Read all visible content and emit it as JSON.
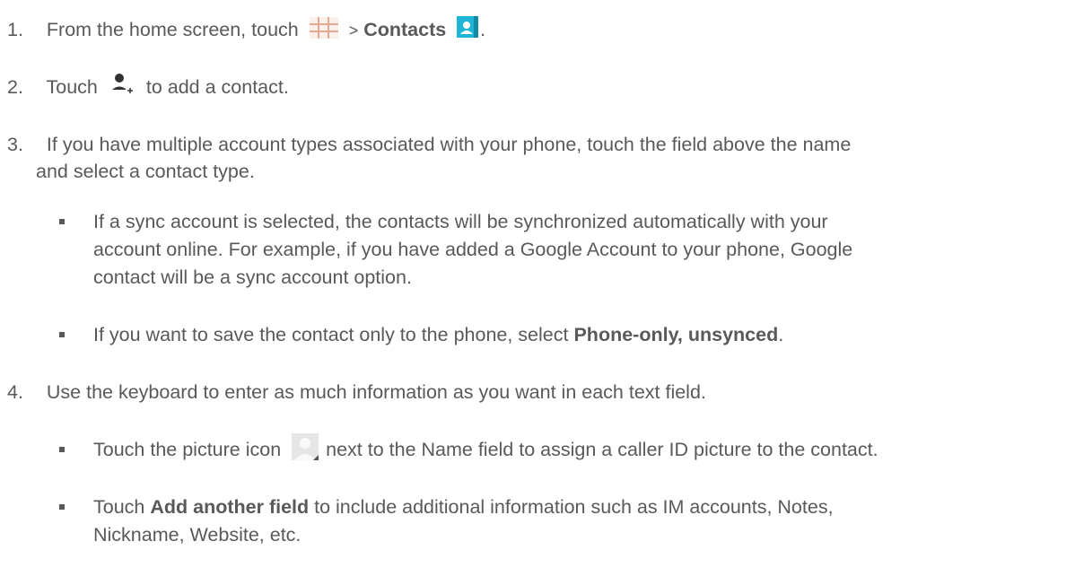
{
  "steps": [
    {
      "number": "1.",
      "pre": "From the home screen, touch",
      "sep": ">",
      "bold": "Contacts",
      "post": "."
    },
    {
      "number": "2.",
      "pre": "Touch",
      "post": "to add a contact."
    },
    {
      "number": "3.",
      "line1": "If you have multiple account types associated with your phone, touch the field above the name",
      "line2": "and select a contact type."
    },
    {
      "number": "4.",
      "text": "Use the keyboard to enter as much information as you want in each text field."
    }
  ],
  "step3_bullets": {
    "b1_line1": "If a sync account is selected, the contacts will be synchronized automatically with your",
    "b1_line2": "account online. For example, if you have added a Google Account to your phone, Google",
    "b1_line3": "contact will be a sync account option.",
    "b2_pre": "If you want to save the contact only to the phone, select",
    "b2_bold": "Phone-only, unsynced",
    "b2_post": "."
  },
  "step4_bullets": {
    "b1_pre": "Touch the picture icon",
    "b1_post": "next to the Name field to assign a caller ID picture to the contact.",
    "b2_pre": "Touch",
    "b2_bold": "Add another field",
    "b2_post": "to include additional information such as IM accounts, Notes,",
    "b2_line2": "Nickname, Website, etc."
  },
  "colors": {
    "text": "#595959",
    "contacts_icon_bg": "#1fb5d6",
    "apps_grid": "#e8b4a8"
  },
  "icons": {
    "apps": "apps-grid-icon",
    "contacts": "contacts-icon",
    "add_contact": "add-contact-icon",
    "picture": "picture-icon"
  }
}
